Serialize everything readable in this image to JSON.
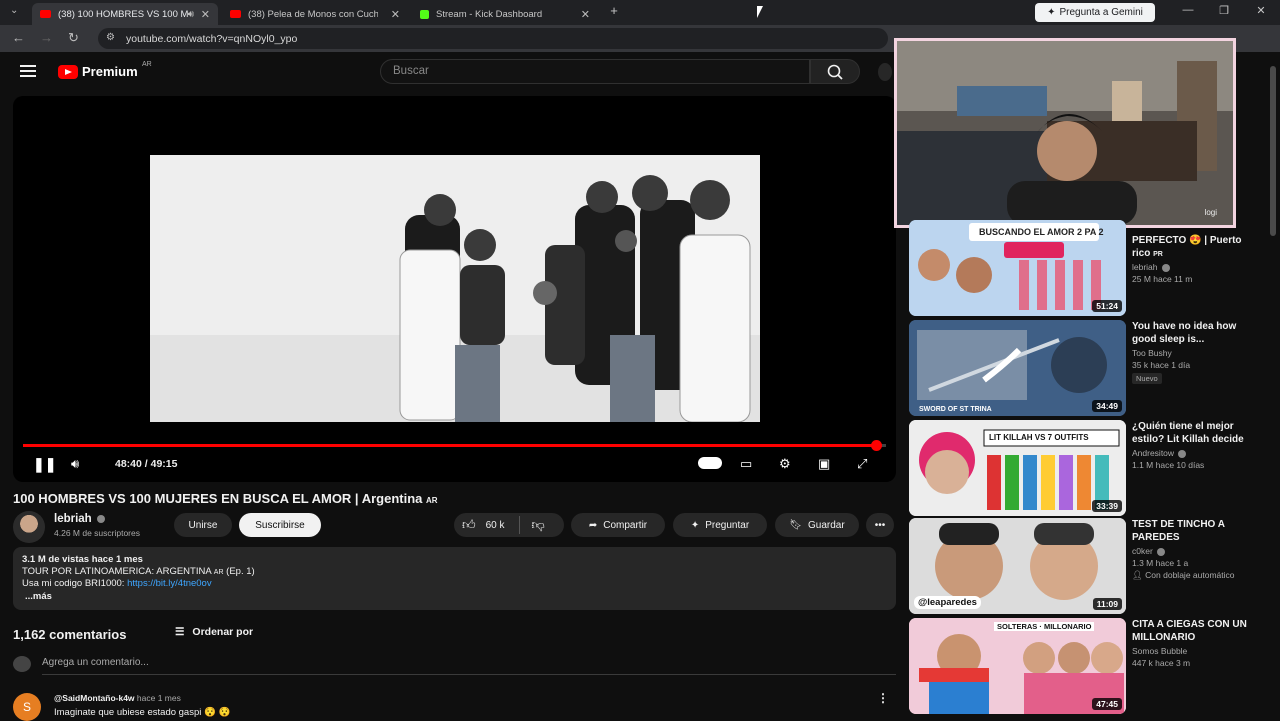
{
  "browser": {
    "tabs": [
      {
        "title": "(38) 100 HOMBRES VS 100 M",
        "active": true
      },
      {
        "title": "(38) Pelea de Monos con Cuch",
        "active": false
      },
      {
        "title": "Stream - Kick Dashboard",
        "active": false
      }
    ],
    "new_tab": "+",
    "gemini_label": "Pregunta a Gemini",
    "url": "youtube.com/watch?v=qnNOyl0_ypo"
  },
  "header": {
    "brand": "Premium",
    "region": "AR",
    "search_placeholder": "Buscar"
  },
  "player": {
    "time": "48:40 / 49:15",
    "progress": 0.988
  },
  "video": {
    "title": "100 HOMBRES VS 100 MUJERES EN BUSCA EL AMOR | Argentina",
    "title_flag": "AR",
    "channel": "lebriah",
    "subscribers": "4.26 M de suscriptores",
    "join_label": "Unirse",
    "subscribe_label": "Suscribirse",
    "likes": "60 k",
    "share_label": "Compartir",
    "ask_label": "Preguntar",
    "save_label": "Guardar"
  },
  "description": {
    "stats": "3.1 M de vistas  hace 1 mes",
    "line1": "TOUR POR LATINOAMERICA: ARGENTINA",
    "line1_flag": "AR",
    "line1_tail": "(Ep. 1)",
    "line2_prefix": "Usa mi codigo BRI1000:",
    "line2_link": "https://bit.ly/4tne0ov",
    "more": "...más"
  },
  "comments": {
    "count": "1,162 comentarios",
    "sort_label": "Ordenar por",
    "add_placeholder": "Agrega un comentario...",
    "first": {
      "avatar_letter": "S",
      "user": "@SaidMontaño-k4w",
      "time": "hace 1 mes",
      "text": "Imaginate que ubiese estado gaspi 😯 😯"
    }
  },
  "webcam": {
    "label": "logi"
  },
  "sidebar": {
    "recs": [
      {
        "thumb_text": "BUSCANDO EL AMOR 2 PA 2",
        "duration": "51:24",
        "title": "PERFECTO 😍 | Puerto rico",
        "title_flag": "PR",
        "channel": "lebriah",
        "meta": "25 M  hace 11 m",
        "badge": ""
      },
      {
        "thumb_text": "SWORD OF ST TRINA",
        "duration": "34:49",
        "title": "You have no idea how good sleep is...",
        "title_flag": "",
        "channel": "Too Bushy",
        "meta": "35 k  hace 1 día",
        "badge": "Nuevo"
      },
      {
        "thumb_text": "LIT KILLAH VS 7 OUTFITS",
        "duration": "33:39",
        "title": "¿Quién tiene el mejor estilo? Lit Killah decide",
        "title_flag": "",
        "channel": "Andresitow",
        "meta": "1.1 M  hace 10 días",
        "badge": ""
      },
      {
        "thumb_text": "@leaparedes",
        "duration": "11:09",
        "title": "TEST DE TINCHO A PAREDES",
        "title_flag": "",
        "channel": "c0ker",
        "meta": "1.3 M  hace 1 a",
        "badge": "Con doblaje automático"
      },
      {
        "thumb_text": "SOLTERAS · MILLONARIO",
        "duration": "47:45",
        "title": "CITA A CIEGAS CON UN MILLONARIO",
        "title_flag": "",
        "channel": "Somos Bubble",
        "meta": "447 k  hace 3 m",
        "badge": ""
      }
    ]
  },
  "colors": {
    "accent": "#ff0000",
    "link": "#3ea6ff",
    "bg": "#0f0f0f"
  }
}
